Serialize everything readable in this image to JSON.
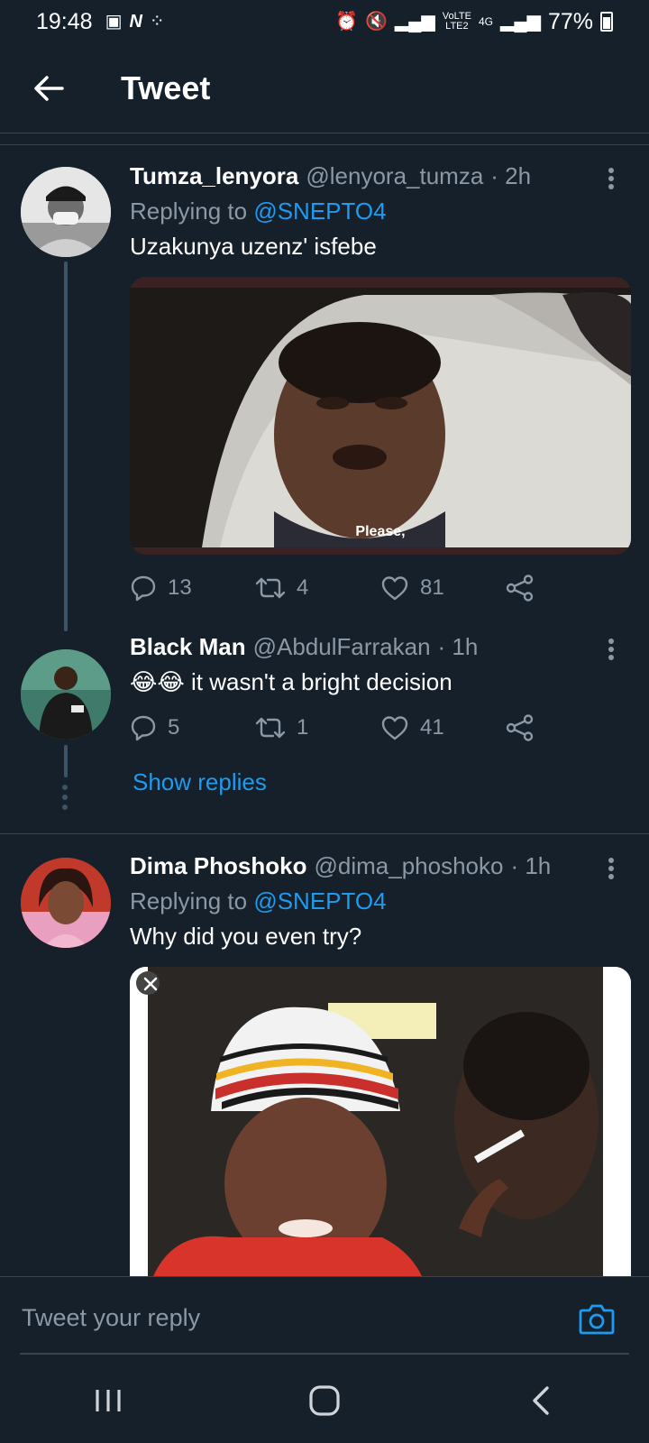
{
  "status_bar": {
    "time": "19:48",
    "battery": "77%"
  },
  "header": {
    "title": "Tweet"
  },
  "tweets": [
    {
      "name": "Tumza_lenyora",
      "handle": "@lenyora_tumza",
      "time": "· 2h",
      "replying_prefix": "Replying to",
      "replying_to": "@SNEPTO4",
      "text": "Uzakunya uzenz' isfebe",
      "media_caption": "Please,",
      "replies": "13",
      "retweets": "4",
      "likes": "81"
    },
    {
      "name": "Black Man",
      "handle": "@AbdulFarrakan",
      "time": "· 1h",
      "emoji": "😂😂",
      "text": "it wasn't a bright decision",
      "replies": "5",
      "retweets": "1",
      "likes": "41",
      "show_replies": "Show replies"
    },
    {
      "name": "Dima Phoshoko",
      "handle": "@dima_phoshoko",
      "time": "· 1h",
      "replying_prefix": "Replying to",
      "replying_to": "@SNEPTO4",
      "text": "Why did you even try?"
    }
  ],
  "reply_bar": {
    "placeholder": "Tweet your reply"
  },
  "colors": {
    "background": "#15202b",
    "accent": "#1d9bf0",
    "muted": "#8b98a5",
    "divider": "#38444d"
  },
  "icons": [
    "back-arrow-icon",
    "reply-icon",
    "retweet-icon",
    "like-icon",
    "share-icon",
    "more-icon",
    "camera-icon",
    "recent-apps-icon",
    "home-icon",
    "nav-back-icon"
  ]
}
